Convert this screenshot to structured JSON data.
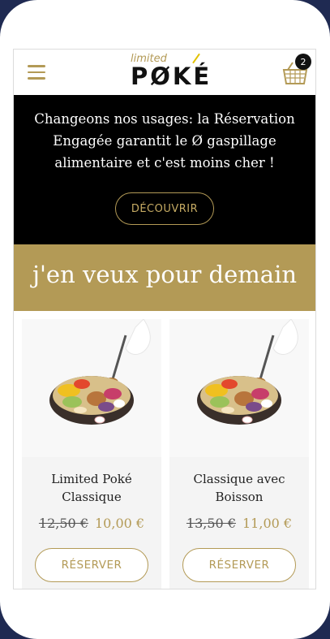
{
  "header": {
    "logo_small": "limited",
    "logo_main": "PØKÉ",
    "cart_count": "2"
  },
  "promo": {
    "text": "Changeons nos usages: la Réservation Engagée garantit le Ø gaspillage alimentaire et c'est moins cher !",
    "button_label": "DÉCOUVRIR"
  },
  "band": {
    "title": "j'en veux pour demain"
  },
  "products": [
    {
      "name": "Limited Poké Classique",
      "old_price": "12,50 €",
      "price": "10,00 €",
      "button_label": "RÉSERVER"
    },
    {
      "name": "Classique avec Boisson",
      "old_price": "13,50 €",
      "price": "11,00 €",
      "button_label": "RÉSERVER"
    }
  ],
  "colors": {
    "gold": "#b39a56",
    "black": "#000000",
    "frame": "#1f2a52"
  }
}
